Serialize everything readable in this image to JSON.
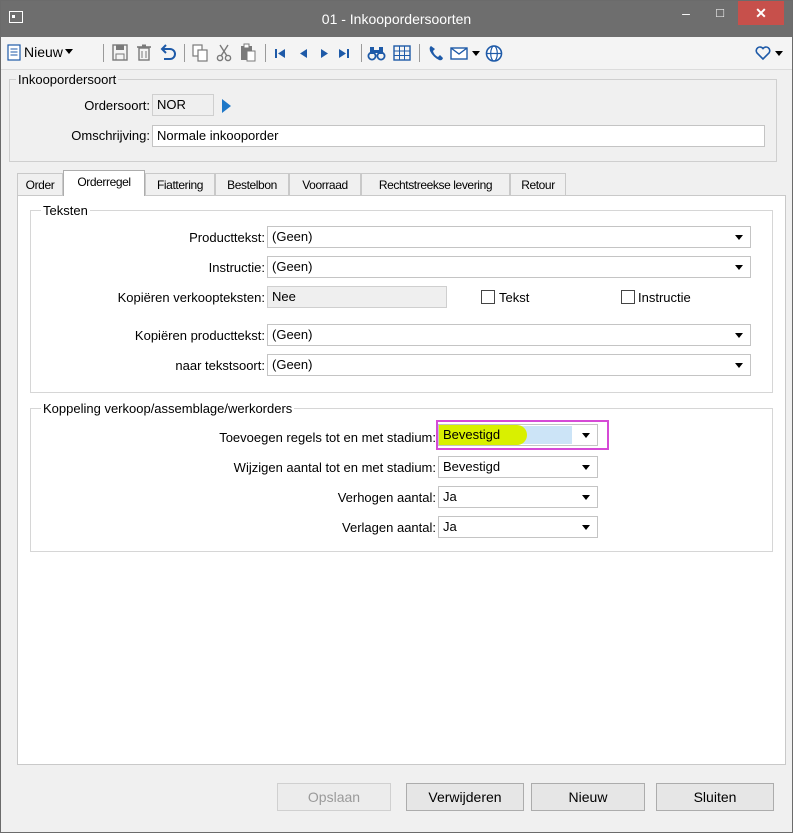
{
  "window": {
    "title": "01 - Inkoopordersoorten",
    "min_label": "–",
    "max_label": "□",
    "close_label": "✕"
  },
  "toolbar": {
    "new_label": "Nieuw",
    "icons": [
      "new-document-icon",
      "save-icon",
      "delete-icon",
      "undo-icon",
      "copy-icon",
      "cut-icon",
      "paste-icon",
      "first-record-icon",
      "previous-record-icon",
      "next-record-icon",
      "last-record-icon",
      "search-binoculars-icon",
      "grid-icon",
      "phone-icon",
      "email-icon",
      "globe-icon",
      "favorite-heart-icon"
    ]
  },
  "header": {
    "group_title": "Inkoopordersoort",
    "ordersoort_label": "Ordersoort:",
    "ordersoort_value": "NOR",
    "omschrijving_label": "Omschrijving:",
    "omschrijving_value": "Normale inkooporder"
  },
  "tabs": [
    "Order",
    "Orderregel",
    "Fiattering",
    "Bestelbon",
    "Voorraad",
    "Rechtstreekse levering",
    "Retour"
  ],
  "active_tab": "Orderregel",
  "teksten": {
    "group_title": "Teksten",
    "producttekst_label": "Producttekst:",
    "producttekst_value": "(Geen)",
    "instructie_label": "Instructie:",
    "instructie_value": "(Geen)",
    "kopieren_verkoop_label": "Kopiëren verkoopteksten:",
    "kopieren_verkoop_value": "Nee",
    "tekst_check_label": "Tekst",
    "instructie_check_label": "Instructie",
    "kopieren_product_label": "Kopiëren producttekst:",
    "kopieren_product_value": "(Geen)",
    "naar_tekstsoort_label": "naar tekstsoort:",
    "naar_tekstsoort_value": "(Geen)"
  },
  "koppeling": {
    "group_title": "Koppeling verkoop/assemblage/werkorders",
    "toevoegen_label": "Toevoegen regels tot en met stadium:",
    "toevoegen_value": "Bevestigd",
    "wijzigen_label": "Wijzigen aantal tot en met stadium:",
    "wijzigen_value": "Bevestigd",
    "verhogen_label": "Verhogen aantal:",
    "verhogen_value": "Ja",
    "verlagen_label": "Verlagen aantal:",
    "verlagen_value": "Ja"
  },
  "buttons": {
    "save": "Opslaan",
    "delete": "Verwijderen",
    "new": "Nieuw",
    "close": "Sluiten"
  },
  "colors": {
    "titlebar": "#6e6e6e",
    "close": "#c7504b",
    "highlight_border": "#d64ad6",
    "highlight_marker": "#d9f000",
    "selection": "#cce4f7",
    "accent": "#1e5aa8"
  }
}
